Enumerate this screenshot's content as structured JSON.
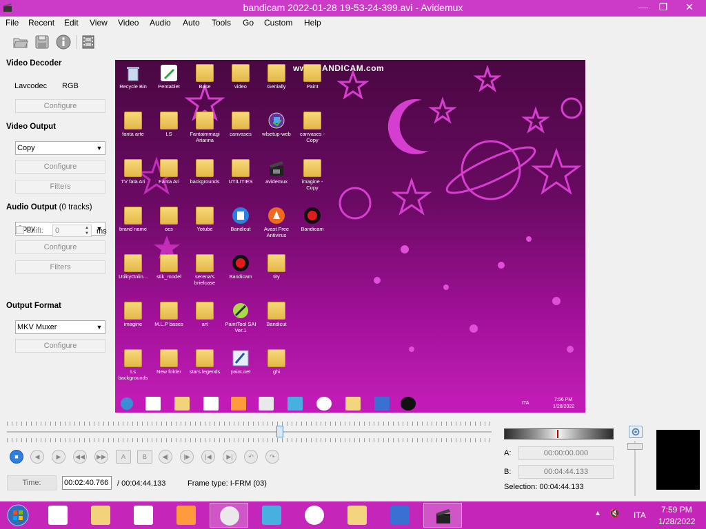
{
  "window": {
    "title": "bandicam 2022-01-28 19-53-24-399.avi - Avidemux",
    "min": "—",
    "max": "❐",
    "close": "✕"
  },
  "menu": [
    "File",
    "Recent",
    "Edit",
    "View",
    "Video",
    "Audio",
    "Auto",
    "Tools",
    "Go",
    "Custom",
    "Help"
  ],
  "toolbar": {
    "open_icon": "open-folder-icon",
    "save_icon": "save-disk-icon",
    "info_icon": "info-icon",
    "filmstrip_icon": "filmstrip-icon"
  },
  "video_decoder": {
    "title": "Video Decoder",
    "codec": "Lavcodec",
    "format": "RGB",
    "configure": "Configure"
  },
  "video_output": {
    "title": "Video Output",
    "codec": "Copy",
    "configure": "Configure",
    "filters": "Filters"
  },
  "audio_output": {
    "title": "Audio Output",
    "tracks": "(0 tracks)",
    "codec": "Copy",
    "configure": "Configure",
    "filters": "Filters",
    "shift_label": "Shift:",
    "shift_value": "0",
    "shift_unit": "ms"
  },
  "output_format": {
    "title": "Output Format",
    "muxer": "MKV Muxer",
    "configure": "Configure"
  },
  "preview": {
    "watermark": "www.BANDICAM.com",
    "icons": [
      "Recycle Bin",
      "Pentablet",
      "Base",
      "video",
      "Genially",
      "Paint",
      "fanta arte",
      "LS",
      "Fantaimmagi Arianna",
      "canvases",
      "wlsetup-web",
      "canvases - Copy",
      "TV fata Ari",
      "Fanta Ari",
      "backgrounds",
      "UTILITIES",
      "avidemux",
      "imagine - Copy",
      "brand name",
      "ocs",
      "Yotube",
      "Bandicut",
      "Avast Free Antivirus",
      "Bandicam",
      "UtilityOnlin...",
      "stik_model",
      "serena's briefcase",
      "Bandicam",
      "tity",
      "imagine",
      "M.L.P bases",
      "art",
      "PaintTool SAI Ver.1",
      "Bandicut",
      "Ls backgrounds",
      "New folder",
      "stars legends",
      "paint.net",
      "ghi"
    ],
    "tray_lang": "ITA",
    "tray_time": "7:56 PM",
    "tray_date": "1/28/2022"
  },
  "timeline": {
    "position": 0.564
  },
  "time": {
    "label": "Time:",
    "current": "00:02:40.766",
    "total": "/ 00:04:44.133",
    "frame_type": "Frame type:  I-FRM (03)"
  },
  "markers": {
    "a_label": "A:",
    "a_value": "00:00:00.000",
    "b_label": "B:",
    "b_value": "00:04:44.133",
    "selection": "Selection: 00:04:44.133"
  },
  "nav_buttons": {
    "a_marker": "A",
    "b_marker": "B"
  },
  "taskbar": {
    "lang": "ITA",
    "time": "7:59 PM",
    "date": "1/28/2022"
  },
  "colors": {
    "title_bar": "#cc3bc7",
    "taskbar": "#c326b8",
    "accent_blue": "#2f7fde"
  }
}
